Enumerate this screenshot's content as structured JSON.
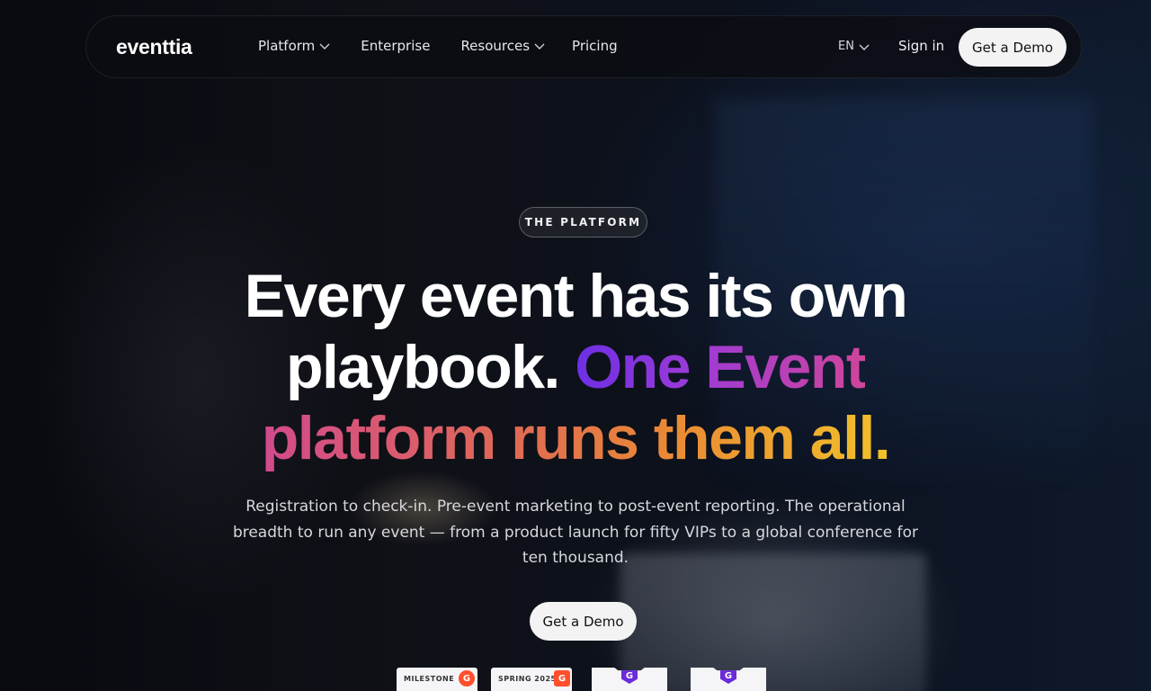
{
  "nav": {
    "logo": "eventtia",
    "links": [
      {
        "label": "Platform",
        "has_dropdown": true
      },
      {
        "label": "Enterprise",
        "has_dropdown": false
      },
      {
        "label": "Resources",
        "has_dropdown": true
      },
      {
        "label": "Pricing",
        "has_dropdown": false
      }
    ],
    "language": "EN",
    "sign_in": "Sign in",
    "cta": "Get a Demo"
  },
  "hero": {
    "eyebrow": "THE PLATFORM",
    "headline": {
      "line1": "Every event has its own",
      "line2_white": "playbook.",
      "line2_gradient": "One Event",
      "line3": "platform runs them all."
    },
    "subtitle": "Registration to check-in. Pre-event marketing to post-event reporting. The operational breadth to run any event — from a product launch for fifty VIPs to a global conference for ten thousand.",
    "cta": "Get a Demo"
  },
  "badges": [
    {
      "label": "MILESTONE",
      "logo": "G"
    },
    {
      "label": "SPRING 2025",
      "logo": "G"
    },
    {
      "label": "",
      "logo": "G"
    },
    {
      "label": "",
      "logo": "G"
    }
  ],
  "colors": {
    "gradient_start": "#7a35e6",
    "gradient_mid": "#d9487f",
    "gradient_end": "#f0b424",
    "button_bg": "#f3f3f4"
  }
}
